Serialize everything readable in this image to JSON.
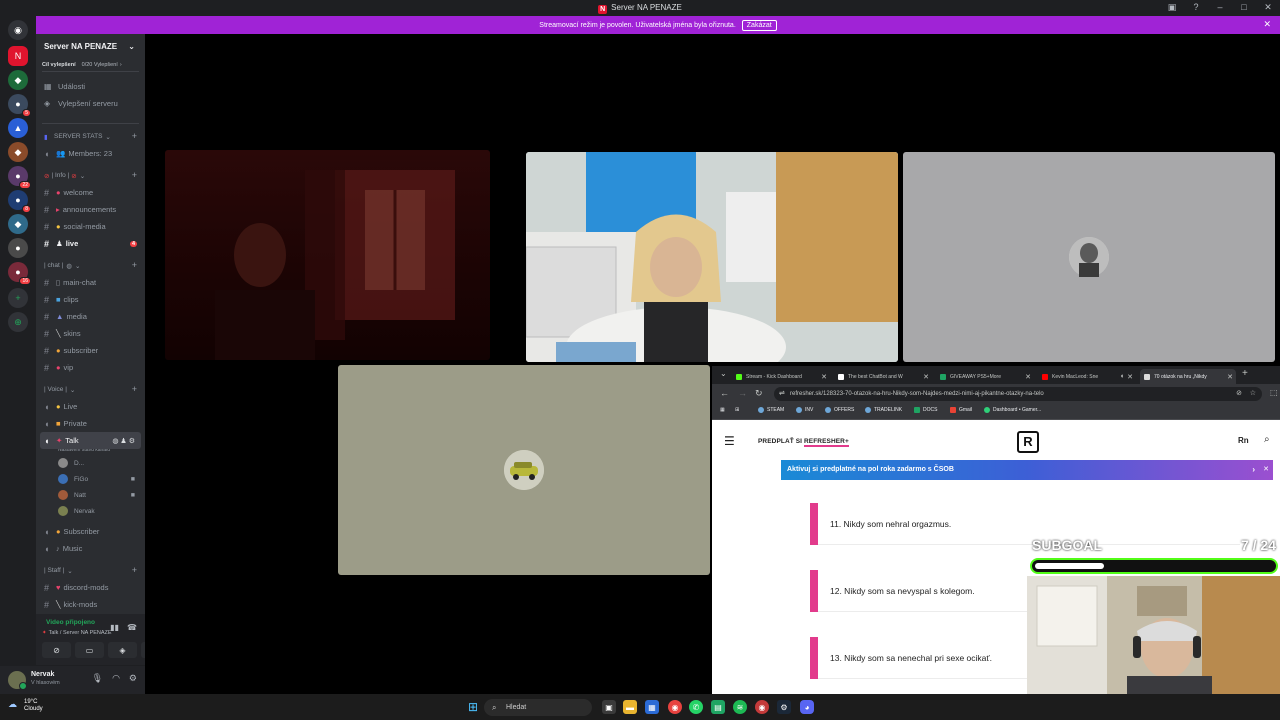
{
  "window": {
    "title": "Server NA PENAZE",
    "logo_letter": "N"
  },
  "banner": {
    "text": "Streamovací režim je povolen. Uživatelská jména byla ořiznuta.",
    "button": "Zakázat"
  },
  "server": {
    "name": "Server NA PENAZE",
    "boost_label": "Cíl vylepšení",
    "boost_progress": "0/20 Vylepšení",
    "menu": [
      {
        "icon": "calendar-icon",
        "label": "Události"
      },
      {
        "icon": "boost-icon",
        "label": "Vylepšení serveru"
      }
    ]
  },
  "sidebar": {
    "cat_stats": "SERVER STATS",
    "members": "Members: 23",
    "cat_info": "| Info |",
    "info_channels": [
      "welcome",
      "announcements",
      "social-media",
      "live"
    ],
    "live_mentions": "4",
    "cat_chat": "| chat |",
    "chat_channels": [
      "main-chat",
      "clips",
      "media",
      "skins",
      "subscriber",
      "vip"
    ],
    "cat_voice": "| Voice |",
    "voice_channels": [
      "Live",
      "Private",
      "Talk"
    ],
    "talk_status": "Nastavení stavu kanálu",
    "voice_users": [
      "D...",
      "FiGo",
      "Natt",
      "Nervak"
    ],
    "voice_channels_2": [
      "Subscriber",
      "Music"
    ],
    "cat_staff": "| Staff |",
    "staff_channels": [
      "discord-mods",
      "kick-mods"
    ]
  },
  "voice_panel": {
    "status": "Video připojeno",
    "channel": "Talk / Server NA PENAZE"
  },
  "user": {
    "name": "Nervak",
    "status": "V hlasovém"
  },
  "browser": {
    "tabs": [
      {
        "label": "Stream - Kick Dashboard",
        "color": "#53fc18"
      },
      {
        "label": "The best ChatBot and W",
        "color": "#ffffff"
      },
      {
        "label": "GIVEAWAY PS5+More",
        "color": "#1fa463"
      },
      {
        "label": "Kevin MacLeod: Sne",
        "color": "#ff0000"
      },
      {
        "label": "70 otázok na hru „Nikdy",
        "color": "#dddddd"
      }
    ],
    "url": "refresher.sk/128323-70-otazok-na-hru-Nikdy-som-Najdes-medzi-nimi-aj-pikantne-otazky-na-telo",
    "bookmarks": [
      {
        "label": "STEAM",
        "color": "#6ea7d8"
      },
      {
        "label": "INV",
        "color": "#6ea7d8"
      },
      {
        "label": "OFFERS",
        "color": "#6ea7d8"
      },
      {
        "label": "TRADELINK",
        "color": "#6ea7d8"
      },
      {
        "label": "DOCS",
        "color": "#1fa463"
      },
      {
        "label": "Gmail",
        "color": "#ea4335"
      },
      {
        "label": "Dashboard • Gamer...",
        "color": "#2fd079"
      }
    ]
  },
  "site": {
    "predplat": "PREDPLAŤ SI",
    "predplat_brand": "REFRESHER+",
    "logo": "R",
    "lang": "Rn",
    "promo": "Aktivuj si predplatné na pol roka zadarmo s ČSOB",
    "questions": [
      "11. Nikdy som nehral orgazmus.",
      "12. Nikdy som sa nevyspal s kolegom.",
      "13. Nikdy som sa nenechal pri sexe ocikať."
    ]
  },
  "subgoal": {
    "label": "SUBGOAL",
    "current": 7,
    "target": 24,
    "count_text": "7  / 24",
    "progress_fraction": 0.29
  },
  "taskbar": {
    "temp": "19°C",
    "weather": "Cloudy",
    "search": "Hledat"
  },
  "colors": {
    "banner": "#a023d6",
    "kick_green": "#53fc18",
    "accent_pink": "#e23b8c",
    "discord_red": "#f23f43",
    "online_green": "#23a55a"
  }
}
